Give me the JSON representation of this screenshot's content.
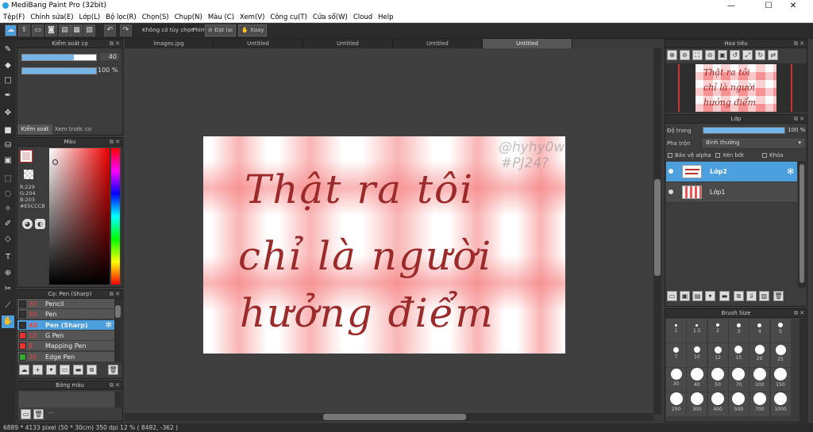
{
  "window": {
    "title": "MediBang Paint Pro (32bit)",
    "minimize": "—",
    "maximize": "☐",
    "close": "✕"
  },
  "menu": [
    "Tệp(F)",
    "Chỉnh sửa(E)",
    "Lớp(L)",
    "Bộ lọc(R)",
    "Chọn(S)",
    "Chụp(N)",
    "Màu (C)",
    "Xem(V)",
    "Công cụ(T)",
    "Cửa sổ(W)",
    "Cloud",
    "Help"
  ],
  "toolbar": {
    "no_option": "Không có tùy chọn",
    "key_label": "Phím",
    "reset_label": "Đặt lại",
    "rotate_label": "Xoay"
  },
  "brush_control": {
    "title": "Kiểm soát cọ",
    "size_value": "40",
    "size_fraction": 0.7,
    "opacity_value": "100 %",
    "opacity_fraction": 1.0,
    "tab_control": "Kiểm soát cọ",
    "tab_preview": "Xem trước cọ"
  },
  "color": {
    "title": "Màu",
    "r": "R:229",
    "g": "G:204",
    "b": "B:203",
    "hex": "#E5CCCB",
    "primary": "#e5cccb"
  },
  "brush_list": {
    "title": "Cọ: Pen (Sharp)",
    "items": [
      {
        "size": "20",
        "name": "Pencil",
        "swatch": "#333333"
      },
      {
        "size": "50",
        "name": "Pen",
        "swatch": "#333333"
      },
      {
        "size": "40",
        "name": "Pen (Sharp)",
        "swatch": "#333333",
        "selected": true
      },
      {
        "size": "10",
        "name": "G Pen",
        "swatch": "#ee3333"
      },
      {
        "size": "8",
        "name": "Mapping Pen",
        "swatch": "#ee3333"
      },
      {
        "size": "20",
        "name": "Edge Pen",
        "swatch": "#33aa33"
      }
    ]
  },
  "palette": {
    "title": "Bảng màu",
    "placeholder": "---"
  },
  "tabs": [
    "images.jpg",
    "Untitled",
    "Untitled",
    "Untitled",
    "Untitled"
  ],
  "artwork": {
    "line1": "Thật ra tôi",
    "line2": "chỉ là người",
    "line3": "hưởng  điểm",
    "watermark1": "@hyhy0w",
    "watermark2": "#PJ24?"
  },
  "navigator": {
    "title": "Hoa tiêu",
    "thumb_line1": "Thật ra tôi",
    "thumb_line2": "chỉ là người",
    "thumb_line3": "hưởng điểm"
  },
  "layers": {
    "title": "Lớp",
    "opacity_label": "Độ trong",
    "opacity_value": "100 %",
    "opacity_fraction": 1.0,
    "blend_label": "Pha trộn",
    "blend_value": "Bình thường",
    "protect_alpha": "Bảo vệ alpha",
    "clipping": "Xén bớt",
    "lock": "Khóa",
    "items": [
      {
        "name": "Lớp2",
        "selected": true
      },
      {
        "name": "Lớp1",
        "selected": false
      }
    ]
  },
  "brush_size": {
    "title": "Brush Size",
    "sizes": [
      "1",
      "1.5",
      "2",
      "3",
      "4",
      "5",
      "7",
      "10",
      "12",
      "15",
      "20",
      "25",
      "30",
      "40",
      "50",
      "70",
      "100",
      "150",
      "200",
      "300",
      "400",
      "500",
      "700",
      "1000"
    ]
  },
  "status": {
    "text": "6889 * 4133 pixel    (50 * 30cm)    350 dpi    12 %    ( 8492, -362 )"
  },
  "colors": {
    "accent": "#4b9fdd",
    "art_red": "#9b2b2b",
    "pink": "#f57878"
  }
}
